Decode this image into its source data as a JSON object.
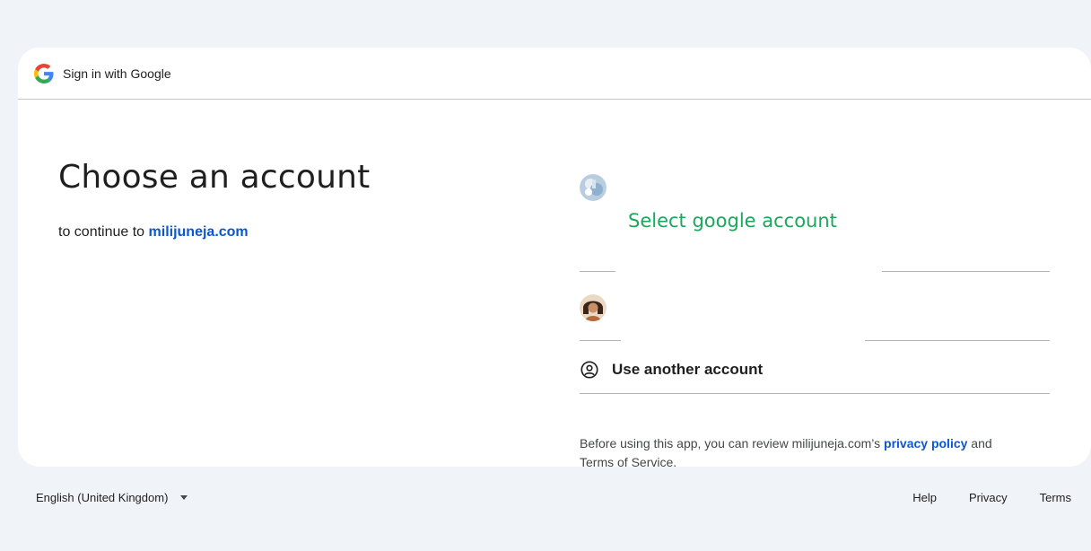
{
  "header": {
    "title": "Sign in with Google",
    "logo_icon": "google-g-icon"
  },
  "main": {
    "title": "Choose an account",
    "subtitle_prefix": "to continue to ",
    "site_name": "milijuneja.com"
  },
  "accounts": [
    {
      "avatar_icon": "account-avatar-photo-1"
    },
    {
      "avatar_icon": "account-avatar-photo-2"
    }
  ],
  "annotation": "Select google account",
  "use_another": {
    "label": "Use another account",
    "icon": "account-circle-icon"
  },
  "legal": {
    "prefix": "Before using this app, you can review milijuneja.com’s ",
    "privacy_link": "privacy policy",
    "middle": " and Terms of Service."
  },
  "footer": {
    "language": "English (United Kingdom)",
    "links": [
      "Help",
      "Privacy",
      "Terms"
    ]
  },
  "colors": {
    "background": "#f0f3f7",
    "link": "#0b57d0",
    "annotation": "#1aa85a"
  }
}
